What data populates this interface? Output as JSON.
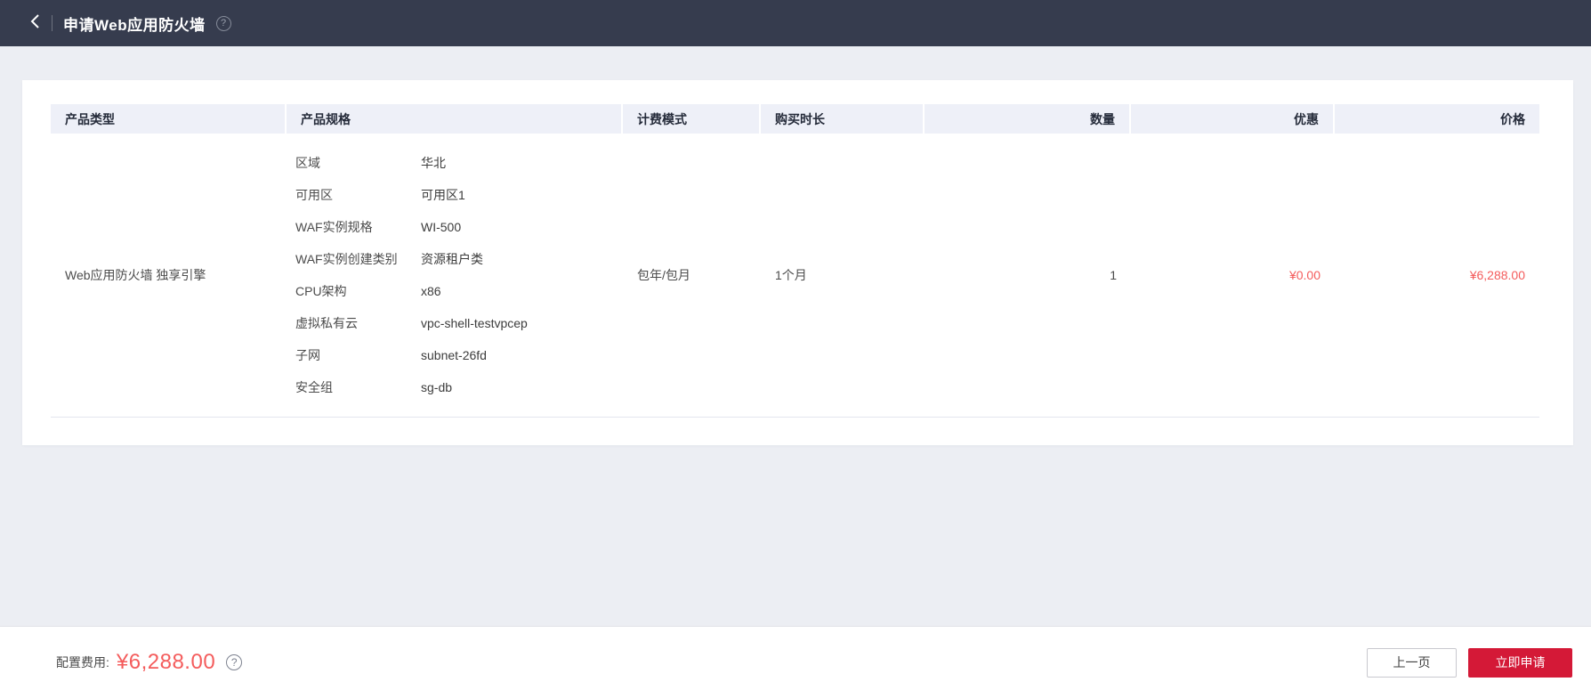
{
  "header": {
    "title": "申请Web应用防火墙"
  },
  "table": {
    "columns": [
      "产品类型",
      "产品规格",
      "计费模式",
      "购买时长",
      "数量",
      "优惠",
      "价格"
    ],
    "row": {
      "product_type": "Web应用防火墙 独享引擎",
      "specs": [
        {
          "label": "区域",
          "value": "华北"
        },
        {
          "label": "可用区",
          "value": "可用区1"
        },
        {
          "label": "WAF实例规格",
          "value": "WI-500"
        },
        {
          "label": "WAF实例创建类别",
          "value": "资源租户类"
        },
        {
          "label": "CPU架构",
          "value": "x86"
        },
        {
          "label": "虚拟私有云",
          "value": "vpc-shell-testvpcep"
        },
        {
          "label": "子网",
          "value": "subnet-26fd"
        },
        {
          "label": "安全组",
          "value": "sg-db"
        }
      ],
      "billing_mode": "包年/包月",
      "duration": "1个月",
      "quantity": "1",
      "discount": "¥0.00",
      "price": "¥6,288.00"
    }
  },
  "footer": {
    "fee_label": "配置费用:",
    "fee_value": "¥6,288.00",
    "prev_button": "上一页",
    "submit_button": "立即申请",
    "help_glyph": "?"
  },
  "icons": {
    "back": "back-chevron",
    "help": "?"
  },
  "colors": {
    "topbar": "#363c4e",
    "page_bg": "#eceef3",
    "table_head_bg": "#eef0f8",
    "price_red": "#f45c5c",
    "accent_red": "#d41937"
  }
}
